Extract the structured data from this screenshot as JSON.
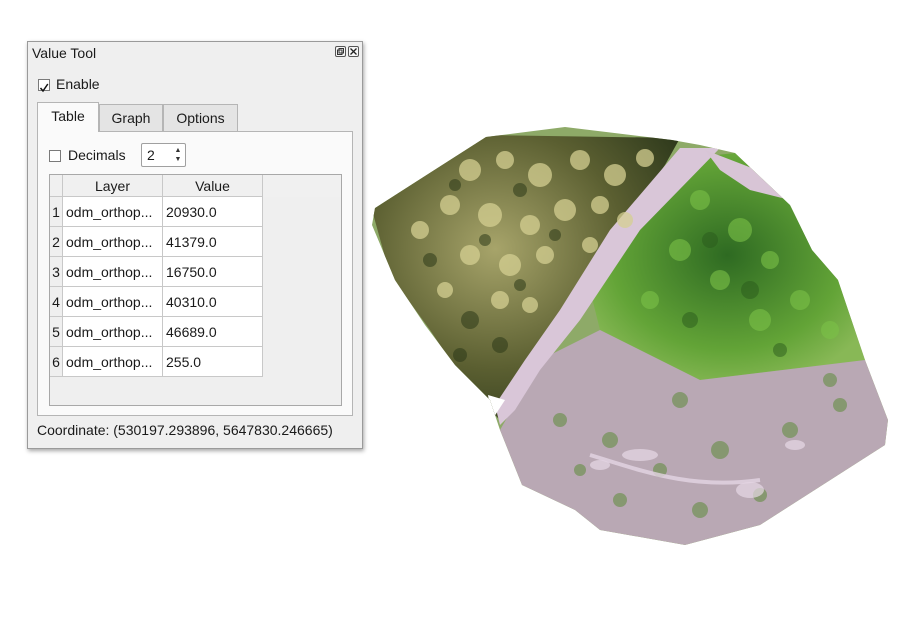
{
  "panel": {
    "title": "Value Tool",
    "float_icon": "float-window-icon",
    "close_icon": "close-icon",
    "enable": {
      "label": "Enable",
      "checked": true
    },
    "tabs": [
      {
        "label": "Table",
        "active": true
      },
      {
        "label": "Graph",
        "active": false
      },
      {
        "label": "Options",
        "active": false
      }
    ],
    "decimals": {
      "label": "Decimals",
      "checked": false,
      "value": "2"
    },
    "table": {
      "headers": [
        "Layer",
        "Value"
      ],
      "rows": [
        {
          "num": "1",
          "layer": "odm_orthop...",
          "value": "20930.0"
        },
        {
          "num": "2",
          "layer": "odm_orthop...",
          "value": "41379.0"
        },
        {
          "num": "3",
          "layer": "odm_orthop...",
          "value": "16750.0"
        },
        {
          "num": "4",
          "layer": "odm_orthop...",
          "value": "40310.0"
        },
        {
          "num": "5",
          "layer": "odm_orthop...",
          "value": "46689.0"
        },
        {
          "num": "6",
          "layer": "odm_orthop...",
          "value": "255.0"
        }
      ]
    },
    "coordinate": "Coordinate: (530197.293896, 5647830.246665)"
  },
  "colors": {
    "panel_bg": "#efefef",
    "canopy_dark": "#3f4a22",
    "canopy_yellow": "#c9c48a",
    "vegetation_green": "#6fa83c",
    "bare_soil_pink": "#d8c3d6"
  }
}
